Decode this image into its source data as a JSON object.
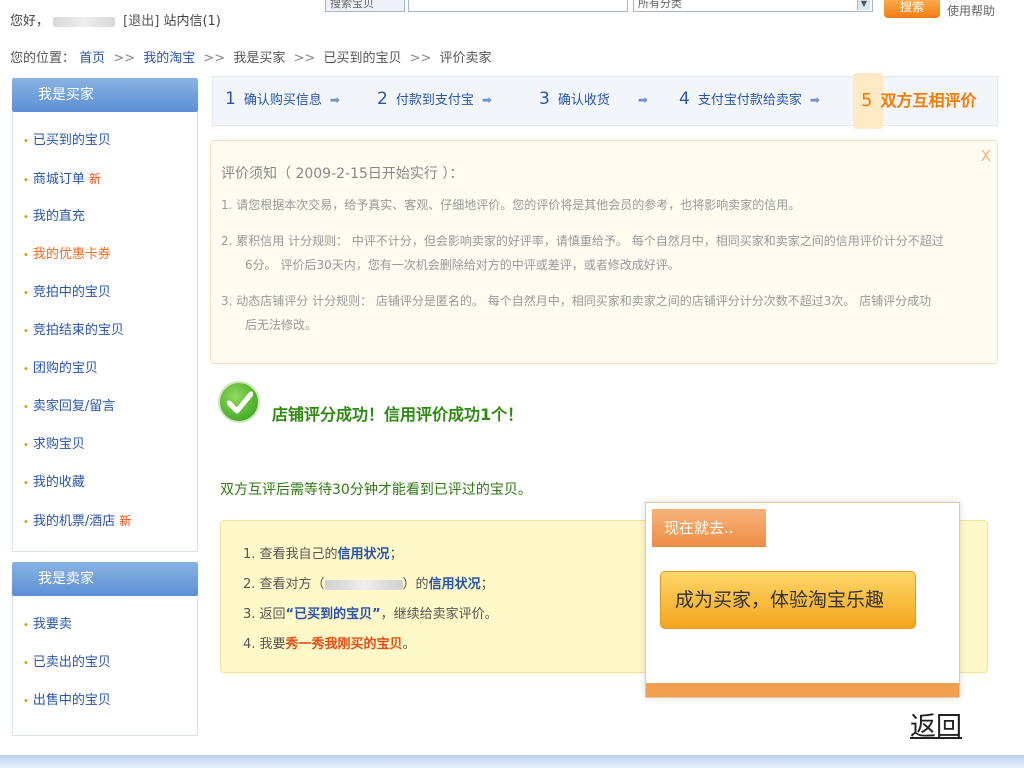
{
  "topbar": {
    "greeting": "您好，",
    "logout": "[退出]",
    "inbox": "站内信(1)",
    "search_type": "搜索宝贝",
    "category": "所有分类",
    "search_btn": "搜索",
    "help": "使用帮助"
  },
  "breadcrumb": {
    "label": "您的位置：",
    "items": [
      "首页",
      "我的淘宝",
      "我是买家",
      "已买到的宝贝",
      "评价卖家"
    ],
    "sep": ">>"
  },
  "buyer": {
    "title": "我是买家",
    "items": [
      {
        "label": "已买到的宝贝"
      },
      {
        "label": "商城订单",
        "badge": "新"
      },
      {
        "label": "我的直充"
      },
      {
        "label": "我的优惠卡券"
      },
      {
        "label": "竞拍中的宝贝"
      },
      {
        "label": "竞拍结束的宝贝"
      },
      {
        "label": "团购的宝贝"
      },
      {
        "label": "卖家回复/留言"
      },
      {
        "label": "求购宝贝"
      },
      {
        "label": "我的收藏"
      },
      {
        "label": "我的机票/酒店",
        "badge": "新"
      }
    ]
  },
  "seller": {
    "title": "我是卖家",
    "items": [
      {
        "label": "我要卖"
      },
      {
        "label": "已卖出的宝贝"
      },
      {
        "label": "出售中的宝贝"
      }
    ]
  },
  "steps": [
    {
      "num": "1",
      "label": "确认购买信息"
    },
    {
      "num": "2",
      "label": "付款到支付宝"
    },
    {
      "num": "3",
      "label": "确认收货"
    },
    {
      "num": "4",
      "label": "支付宝付款给卖家"
    },
    {
      "num": "5",
      "label": "双方互相评价"
    }
  ],
  "notice": {
    "title": "评价须知（ 2009-2-15日开始实行 ）：",
    "close": "X",
    "item1": "1.  请您根据本次交易，给予真实、客观、仔细地评价。您的评价将是其他会员的参考，也将影响卖家的信用。",
    "item2a": "2.  累积信用  计分规则：  中评不计分，但会影响卖家的好评率，请慎重给予。  每个自然月中，相同买家和卖家之间的信用评价计分不超过",
    "item2b": "6分。  评价后30天内，您有一次机会删除给对方的中评或差评，或者修改成好评。",
    "item3a": "3.  动态店铺评分  计分规则：  店铺评分是匿名的。  每个自然月中，相同买家和卖家之间的店铺评分计分次数不超过3次。  店铺评分成功",
    "item3b": "后无法修改。"
  },
  "success": "店铺评分成功！信用评价成功1个！",
  "wait": "双方互评后需等待30分钟才能看到已评过的宝贝。",
  "tips": {
    "t1_pre": "1.  查看我自己的",
    "t1_link": "信用状况",
    "t1_post": "；",
    "t2_pre": "2.  查看对方（",
    "t2_mid": "）的",
    "t2_link": "信用状况",
    "t2_post": "；",
    "t3_pre": "3.  返回",
    "t3_link": "“已买到的宝贝”",
    "t3_post": "，继续给卖家评价。",
    "t4_pre": "4.  我要",
    "t4_link": "秀一秀我刚买的宝贝",
    "t4_post": "。"
  },
  "popup": {
    "head": "现在就去..",
    "cta": "成为买家，体验淘宝乐趣"
  },
  "back": "返回"
}
